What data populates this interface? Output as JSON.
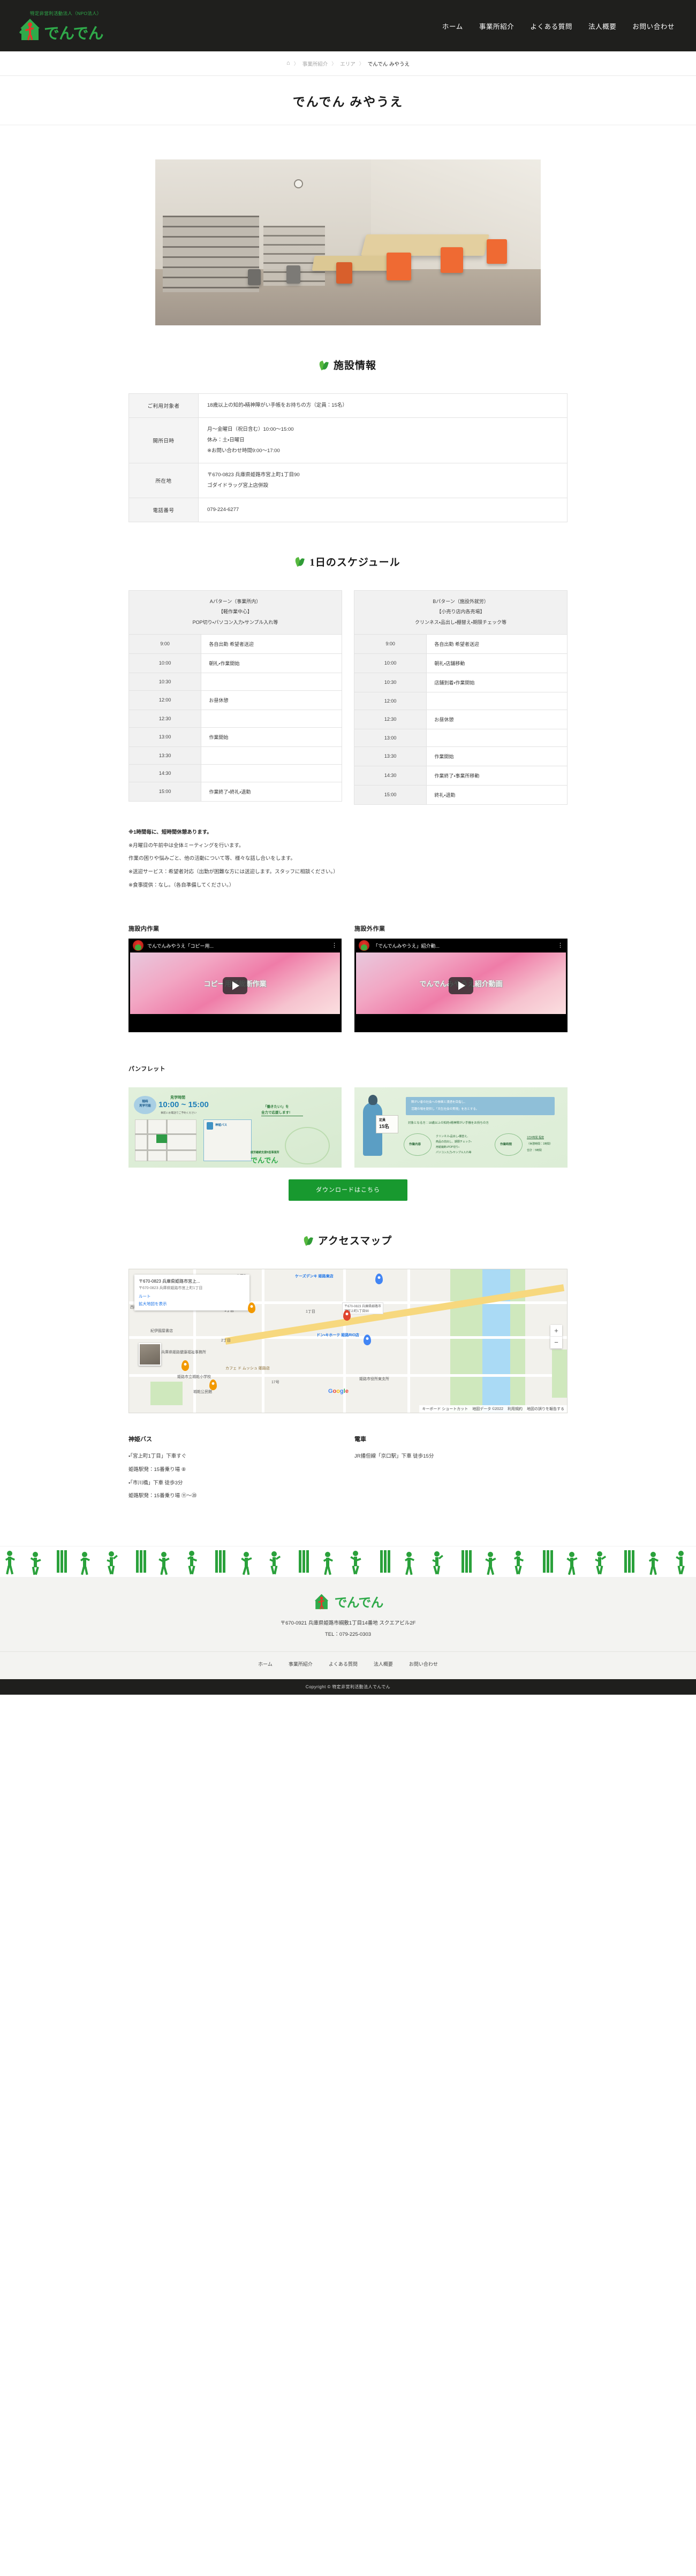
{
  "header": {
    "logo_sub": "特定非営利活動法人（NPO法人）",
    "logo_text": "でんでん",
    "nav": [
      {
        "label": "ホーム"
      },
      {
        "label": "事業所紹介"
      },
      {
        "label": "よくある質問"
      },
      {
        "label": "法人概要"
      },
      {
        "label": "お問い合わせ"
      }
    ]
  },
  "breadcrumb": {
    "home_icon": "home-icon",
    "items": [
      {
        "label": "事業所紹介"
      },
      {
        "label": "エリア"
      }
    ],
    "current": "でんでん みやうえ",
    "separator": "〉"
  },
  "page_title": "でんでん みやうえ",
  "facility": {
    "heading": "施設情報",
    "rows": [
      {
        "label": "ご利用対象者",
        "lines": [
          "18歳以上の知的・精神障がい手帳をお持ちの方（定員：15名）"
        ]
      },
      {
        "label": "開所日時",
        "lines": [
          "月〜金曜日（祝日含む）10:00〜15:00",
          "休み：土・日曜日",
          "※お問い合わせ時間9:00〜17:00"
        ]
      },
      {
        "label": "所在地",
        "lines": [
          "〒670-0823 兵庫県姫路市宮上町1丁目90",
          "ゴダイドラッグ宮上店併設"
        ]
      },
      {
        "label": "電話番号",
        "lines": [
          "079-224-6277"
        ]
      }
    ]
  },
  "schedule": {
    "heading": "1日のスケジュール",
    "patterns": [
      {
        "head_lines": [
          "Aパターン（事業所内）",
          "【軽作業中心】",
          "POP切り・パソコン入力・サンプル入れ等"
        ],
        "rows": [
          {
            "time": "9:00",
            "activity": "各自出勤 希望者送迎"
          },
          {
            "time": "10:00",
            "activity": "朝礼・作業開始"
          },
          {
            "time": "10:30",
            "activity": ""
          },
          {
            "time": "12:00",
            "activity": "お昼休憩"
          },
          {
            "time": "12:30",
            "activity": ""
          },
          {
            "time": "13:00",
            "activity": "作業開始"
          },
          {
            "time": "13:30",
            "activity": ""
          },
          {
            "time": "14:30",
            "activity": ""
          },
          {
            "time": "15:00",
            "activity": "作業終了・終礼・退勤"
          }
        ]
      },
      {
        "head_lines": [
          "Bパターン（施設外就労）",
          "【小売り店内各売場】",
          "クリンネス・品出し・棚替え・期限チェック等"
        ],
        "rows": [
          {
            "time": "9:00",
            "activity": "各自出勤 希望者送迎"
          },
          {
            "time": "10:00",
            "activity": "朝礼・店舗移動"
          },
          {
            "time": "10:30",
            "activity": "店舗到着・作業開始"
          },
          {
            "time": "12:00",
            "activity": ""
          },
          {
            "time": "12:30",
            "activity": "お昼休憩"
          },
          {
            "time": "13:00",
            "activity": ""
          },
          {
            "time": "13:30",
            "activity": "作業開始"
          },
          {
            "time": "14:30",
            "activity": "作業終了・事業所移動"
          },
          {
            "time": "15:00",
            "activity": "終礼・退勤"
          }
        ]
      }
    ],
    "notes": [
      {
        "text": "※1時間毎に、短時間休憩あります。",
        "bold": true
      },
      {
        "text": "※月曜日の午前中は全体ミーティングを行います。",
        "bold": false
      },
      {
        "text": "作業の困りや悩みごと、他の活動について等、様々な話し合いをします。",
        "bold": false
      },
      {
        "text": "※送迎サービス：希望者対応（出勤が困難な方には送迎します。スタッフに相談ください。）",
        "bold": false
      },
      {
        "text": "※食事提供：なし。（各自準備してください。）",
        "bold": false
      }
    ]
  },
  "videos": [
    {
      "section_label": "施設内作業",
      "channel_title": "でんでんみやうえ「コピー用...",
      "thumb_text": "コピー用紙裁断作業",
      "menu_icon": "kebab-menu-icon",
      "play_icon": "play-icon"
    },
    {
      "section_label": "施設外作業",
      "channel_title": "「でんでんみやうえ」紹介動...",
      "thumb_text": "でんでんみやうえ紹介動画",
      "menu_icon": "kebab-menu-icon",
      "play_icon": "play-icon"
    }
  ],
  "pamphlet": {
    "section_label": "パンフレット",
    "left": {
      "badge": "随時\n見学可能",
      "title": "見学時間",
      "time": "10:00 ~ 15:00",
      "note": "事前にお電話でご予約ください",
      "catch_line1": "「働きたい!」を",
      "catch_line2": "全力で応援します!",
      "bus_label": "神姫バス",
      "org_note": "就労継続支援B型事業所",
      "logo_text": "でんでん\nみやうえ"
    },
    "right": {
      "capacity_label": "定員",
      "capacity_value": "15名",
      "mission_line1": "障がい者の社会への参画と浸透を目指し、",
      "mission_line2": "活躍の場を提供し「共生社会の実現」を志とする。",
      "target": "対象となる方：18歳以上の知的・精神障がい手帳をお持ちの方",
      "work_label": "作業内容",
      "work_lines": [
        "クリンネス・品出し・棚替え、",
        "商品の前出し、期限チェック・",
        "用紙裁断・POP切り・",
        "パソコン入力・サンプル入れ等"
      ],
      "time_label": "作業時間",
      "time_lines": [
        "1日4時間 程度",
        "（休憩時間：1時間）",
        "合計：5時間"
      ]
    },
    "download_button": "ダウンロードはこちら"
  },
  "access": {
    "heading": "アクセスマップ",
    "map": {
      "card_title": "〒670-0823 兵庫県姫路市宮上...",
      "card_sub": "〒670-0823 兵庫県姫路市宮上町1丁目",
      "card_route": "ルート",
      "card_more": "拡大地図を表示",
      "zoom_in": "+",
      "zoom_out": "−",
      "labels": [
        "若菜町",
        "1丁目",
        "2丁目",
        "1丁目",
        "西町",
        "播磨屋本店 姫路店",
        "ケーズデンキ 姫路東店",
        "ドン・キホーテ 姫路RIO店",
        "カフェ ド ムッシュ 姫路店",
        "兵庫県姫路健康福祉事務所",
        "姫路市立城乾小学校",
        "城乾公民館",
        "姫路市役所東支所",
        "紀伊國屋書店",
        "17号"
      ],
      "pin_label": "〒670-0823 兵庫県姫路市\n市宮上町1丁目90",
      "google_mark": "Google",
      "footer_items": [
        "キーボード ショートカット",
        "地図データ ©2022",
        "利用規約",
        "地図の誤りを報告する"
      ]
    },
    "columns": [
      {
        "title": "神姫バス",
        "lines": [
          "・「宮上町1丁目」下車すぐ",
          "姫路駅発：15番乗り場 ⑧",
          "・「市川橋」下車 徒歩3分",
          "姫路駅発：15番乗り場 ⑪〜⑳"
        ]
      },
      {
        "title": "電車",
        "lines": [
          "JR播但線「京口駅」下車 徒歩15分"
        ]
      }
    ]
  },
  "footer": {
    "logo_text": "でんでん",
    "address": "〒670-0921 兵庫県姫路市綱敷1丁目14番地 スクエアビル2F",
    "tel": "TEL：079-225-0303",
    "nav": [
      {
        "label": "ホーム"
      },
      {
        "label": "事業所紹介"
      },
      {
        "label": "よくある質問"
      },
      {
        "label": "法人概要"
      },
      {
        "label": "お問い合わせ"
      }
    ],
    "copyright": "Copyright © 特定非営利活動法人でんでん"
  },
  "colors": {
    "brand_green": "#2faa4a",
    "dark": "#1f1f1d",
    "button_green": "#18992f"
  }
}
